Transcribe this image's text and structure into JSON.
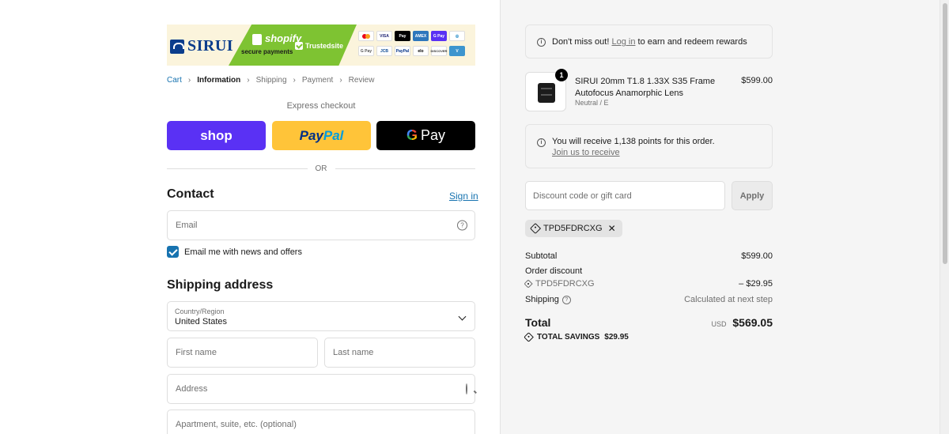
{
  "banner": {
    "brand_name": "SIRUI",
    "brand_small": "SIRUI",
    "shopify_label": "shopify",
    "shopify_sub": "secure payments",
    "trusted_label": "Trustedsite",
    "payment_icons": [
      "mastercard",
      "VISA",
      "Pay",
      "AMEX",
      "G Pay",
      "diners",
      "G Pay",
      "JCB",
      "PayPal",
      "elo",
      "DISCOVER",
      "V"
    ]
  },
  "breadcrumb": {
    "items": [
      "Cart",
      "Information",
      "Shipping",
      "Payment",
      "Review"
    ]
  },
  "express": {
    "title": "Express checkout",
    "shop_label": "shop",
    "paypal_p1": "Pay",
    "paypal_p2": "Pal",
    "gpay_g": "G",
    "gpay_label": "Pay",
    "or_label": "OR"
  },
  "contact": {
    "title": "Contact",
    "signin_label": "Sign in",
    "email_placeholder": "Email",
    "newsletter_label": "Email me with news and offers"
  },
  "shipping": {
    "title": "Shipping address",
    "country_label": "Country/Region",
    "country_value": "United States",
    "first_name_placeholder": "First name",
    "last_name_placeholder": "Last name",
    "address_placeholder": "Address",
    "apartment_placeholder": "Apartment, suite, etc. (optional)"
  },
  "rewards": {
    "text": "Don't miss out!",
    "link": "Log in",
    "suffix": "to earn and redeem rewards"
  },
  "product": {
    "quantity": "1",
    "name": "SIRUI 20mm T1.8 1.33X S35 Frame Autofocus Anamorphic Lens",
    "variant": "Neutral / E",
    "price": "$599.00"
  },
  "points": {
    "text": "You will receive 1,138 points for this order.",
    "link": "Join us to receive"
  },
  "discount": {
    "placeholder": "Discount code or gift card",
    "apply_label": "Apply",
    "applied_code": "TPD5FDRCXG"
  },
  "summary": {
    "subtotal_label": "Subtotal",
    "subtotal_value": "$599.00",
    "order_discount_label": "Order discount",
    "discount_code": "TPD5FDRCXG",
    "discount_value": "– $29.95",
    "shipping_label": "Shipping",
    "shipping_value": "Calculated at next step",
    "total_label": "Total",
    "currency": "USD",
    "total_value": "$569.05",
    "savings_label": "TOTAL SAVINGS",
    "savings_value": "$29.95"
  },
  "colors": {
    "accent_link": "#1773b0",
    "shop_purple": "#5a31f4",
    "paypal_yellow": "#ffc439",
    "shopify_green": "#7ec332"
  }
}
